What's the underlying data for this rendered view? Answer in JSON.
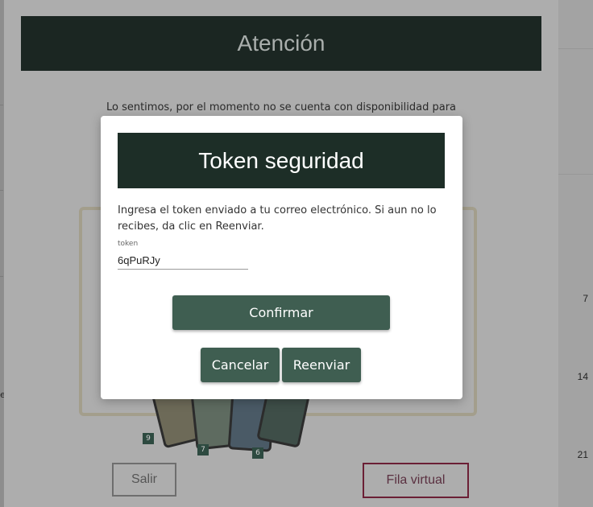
{
  "outer_modal": {
    "title": "Atención",
    "message": "Lo sentimos, por el momento no se cuenta con disponibilidad para",
    "exit_label": "Salir",
    "virtual_queue_label": "Fila virtual",
    "card_tags": [
      "9",
      "7",
      "6"
    ]
  },
  "background": {
    "calendar_numbers": [
      "7",
      "14",
      "21"
    ],
    "left_text": "el"
  },
  "token_modal": {
    "title": "Token seguridad",
    "message": "Ingresa el token enviado a tu correo electrónico. Si aun no lo recibes, da clic en Reenviar.",
    "field_label": "token",
    "field_value": "6qPuRJy",
    "confirm_label": "Confirmar",
    "cancel_label": "Cancelar",
    "resend_label": "Reenviar"
  },
  "colors": {
    "header_bg": "#1d2e27",
    "button_bg": "#3f5e51",
    "fila_border": "#6b1f35"
  }
}
